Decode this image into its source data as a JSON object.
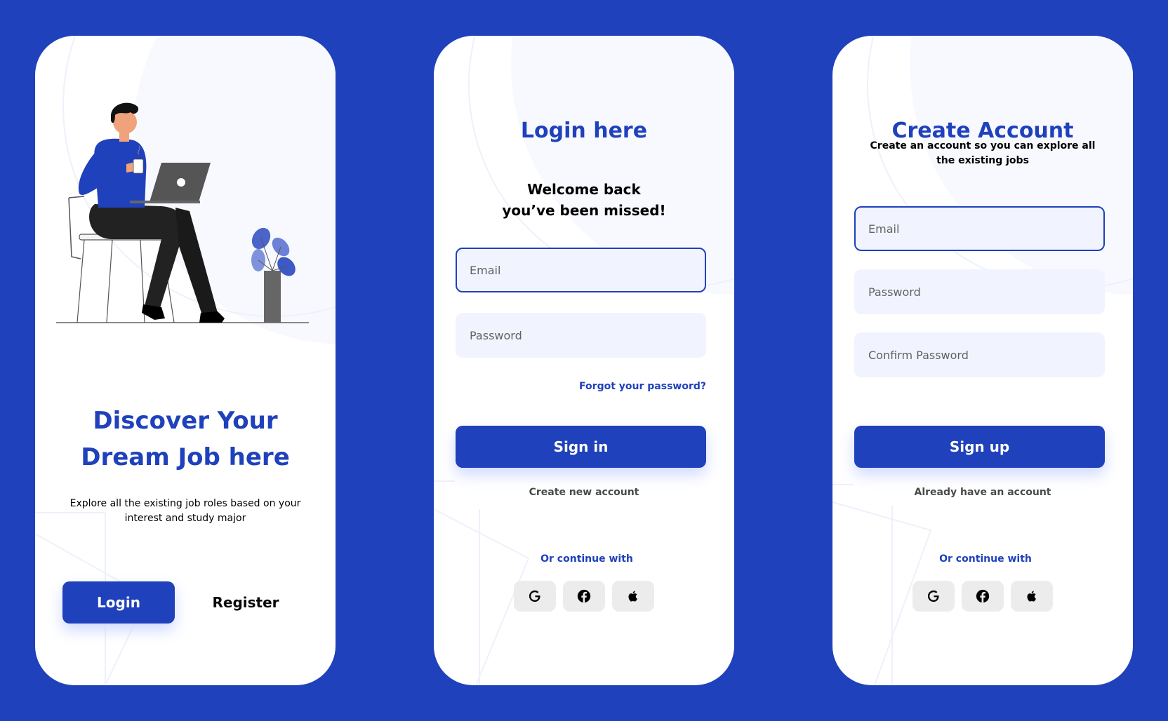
{
  "colors": {
    "background": "#1f41bb",
    "primary": "#1f41bb",
    "field_bg": "#f1f4ff"
  },
  "welcome": {
    "title_line1": "Discover Your",
    "title_line2": "Dream Job here",
    "description": "Explore all the existing job roles based on your interest and study major",
    "login_label": "Login",
    "register_label": "Register"
  },
  "login": {
    "title": "Login here",
    "subtitle": "Welcome back you’ve been missed!",
    "email_placeholder": "Email",
    "password_placeholder": "Password",
    "forgot_label": "Forgot your password?",
    "signin_label": "Sign in",
    "create_account_label": "Create new account",
    "continue_label": "Or continue with",
    "social_icons": [
      "google-icon",
      "facebook-icon",
      "apple-icon"
    ]
  },
  "register": {
    "title": "Create Account",
    "subtitle": "Create an account so you can explore all the existing jobs",
    "email_placeholder": "Email",
    "password_placeholder": "Password",
    "confirm_placeholder": "Confirm Password",
    "signup_label": "Sign up",
    "already_label": "Already have an account",
    "continue_label": "Or continue with",
    "social_icons": [
      "google-icon",
      "facebook-icon",
      "apple-icon"
    ]
  }
}
